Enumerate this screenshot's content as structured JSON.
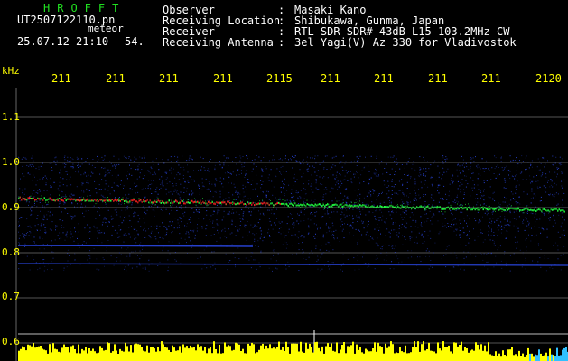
{
  "header": {
    "app_title": "HROFFT",
    "filename": "UT2507122110.pn",
    "type_label": "meteor",
    "datetime": "25.07.12 21:10",
    "count": "54.",
    "rows": [
      {
        "label": "Observer",
        "sep": ":",
        "value": "Masaki Kano"
      },
      {
        "label": "Receiving Location",
        "sep": ":",
        "value": "Shibukawa, Gunma, Japan"
      },
      {
        "label": "Receiver",
        "sep": ":",
        "value": "RTL-SDR SDR# 43dB L15 103.2MHz CW"
      },
      {
        "label": "Receiving Antenna",
        "sep": ":",
        "value": "3el Yagi(V) Az 330 for Vladivostok"
      }
    ]
  },
  "spectrogram": {
    "unit_label": "kHz",
    "x_ticks": [
      "211",
      "211",
      "211",
      "211",
      "2115",
      "211",
      "211",
      "211",
      "211",
      "2120"
    ],
    "y_ticks": [
      "1.1",
      "1.0",
      "0.9",
      "0.8",
      "0.7",
      "0.6"
    ],
    "colors": {
      "axis": "#ffff00",
      "signal_hot": "#ff2020",
      "signal_warm": "#20ff40",
      "noise": "#3050ff",
      "background": "#000000",
      "level": "#ffff00"
    }
  }
}
